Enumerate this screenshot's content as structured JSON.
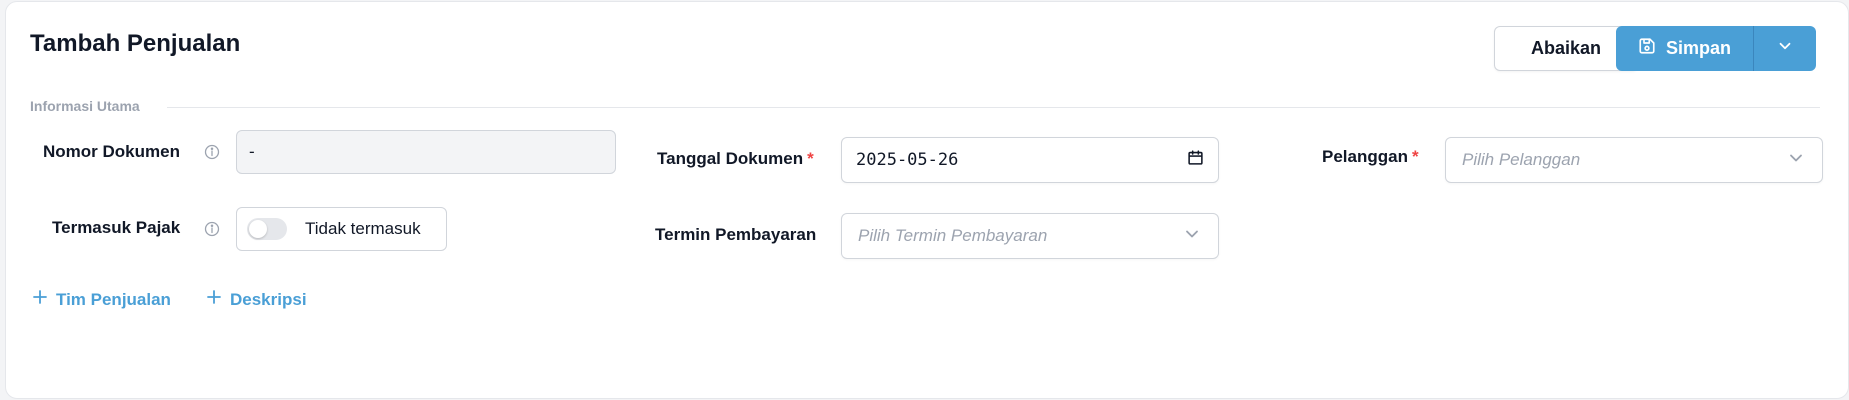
{
  "header": {
    "title": "Tambah Penjualan",
    "ignore_label": "Abaikan",
    "save_label": "Simpan"
  },
  "section": {
    "label": "Informasi Utama"
  },
  "form": {
    "document_number": {
      "label": "Nomor Dokumen",
      "value": "-"
    },
    "include_tax": {
      "label": "Termasuk Pajak",
      "toggle_text": "Tidak termasuk",
      "enabled": false
    },
    "document_date": {
      "label": "Tanggal Dokumen",
      "required_mark": "*",
      "value": "2025-05-26"
    },
    "payment_term": {
      "label": "Termin Pembayaran",
      "placeholder": "Pilih Termin Pembayaran"
    },
    "customer": {
      "label": "Pelanggan",
      "required_mark": "*",
      "placeholder": "Pilih Pelanggan"
    }
  },
  "links": {
    "sales_team": "Tim Penjualan",
    "description": "Deskripsi",
    "plus": "+"
  },
  "colors": {
    "accent": "#4a9fd6",
    "required": "#ef4444"
  }
}
